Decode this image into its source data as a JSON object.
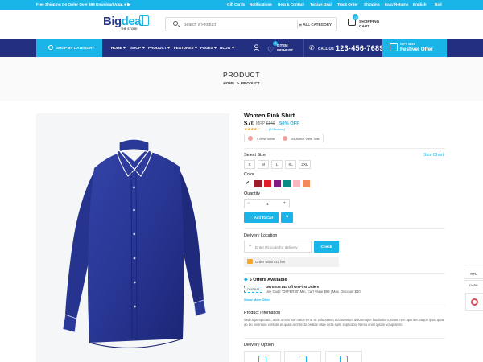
{
  "topbar": {
    "shipping": "Free Shipping On Order Over $99",
    "download": "Download App",
    "links": [
      "Gift Cards",
      "Notifications",
      "Help & Contact",
      "Todays Deal",
      "Track Order",
      "Shipping",
      "Easy Returns"
    ],
    "language": "English",
    "currency": "Usd"
  },
  "header": {
    "logo_big": "Big",
    "logo_deal": "deal",
    "logo_sub": "THE STORE",
    "search_placeholder": "Search a Product",
    "category": "ALL CATEGORY",
    "cart_count": "0",
    "cart_label_1": "SHOPPING",
    "cart_label_2": "CART"
  },
  "nav": {
    "shop_by_category": "SHOP BY CATEGORY",
    "items": [
      "HOME",
      "SHOP",
      "PRODUCT",
      "FEATURES",
      "PAGES",
      "BLOG"
    ],
    "wishlist_count": "0",
    "wishlist_1": "0 ITEM",
    "wishlist_2": "WISHLIST",
    "call_label": "CALL US",
    "phone": "123-456-76890",
    "gift_1": "GIFT BOX",
    "gift_2": "Festivel Offer"
  },
  "page": {
    "title": "PRODUCT",
    "breadcrumb": [
      "HOME",
      ">",
      "PRODUCT"
    ]
  },
  "product": {
    "name": "Women Pink Shirt",
    "price": "$70",
    "mrp_label": "MRP",
    "mrp": "$140",
    "discount": "50% OFF",
    "stars": "★★★★☆",
    "rating": 4,
    "reviews": "(6 Reviews)",
    "badges": [
      "5 Best Seller",
      "44 Active View This"
    ],
    "size_label": "Select Size",
    "size_chart": "Size Chart",
    "sizes": [
      "S",
      "M",
      "L",
      "XL",
      "2XL"
    ],
    "color_label": "Color",
    "colors": [
      "#ffffff",
      "#9e1b2c",
      "#e21b2d",
      "#801a7e",
      "#0a8a84",
      "#f7b6c0",
      "#f08a5c"
    ],
    "selected_color_mark": "✔",
    "qty_label": "Quantity",
    "qty_minus": "−",
    "qty_value": "1",
    "qty_plus": "+",
    "add_to_cart": "Add To Cart",
    "wishlist_icon": "heart-icon",
    "delivery_label": "Delivery Location",
    "pincode_placeholder": "Enter Pincode for delivery",
    "check": "Check",
    "order_within": "Order within 12 hrs",
    "offers_title": "5 Offers Available",
    "offer_code": "OFFER40",
    "offer_title": "Get Extra $40 Off On First Orders",
    "offer_desc": "Use Code \"OFFER40\" Min. Cart Value $99 | Max. Discount $40",
    "show_more": "Show More Offer",
    "info_title": "Product Infomation",
    "info_text": "Sed ut perspiciatis, unde omnis iste natus error sit voluptatem accusantium doloremque laudantium, totam rem aperiam eaque ipsa, quae ab illo inventore veritatis et quasi architecto beatae vitae dicta sunt, explicabo. Nemo enim ipsam voluptatem.",
    "delivery_option": "Delivery Option"
  },
  "side": {
    "rtl": "RTL",
    "dark": "DARK"
  },
  "colors": {
    "accent": "#19b5e8",
    "nav": "#232f80",
    "shirt": "#2a3898"
  }
}
